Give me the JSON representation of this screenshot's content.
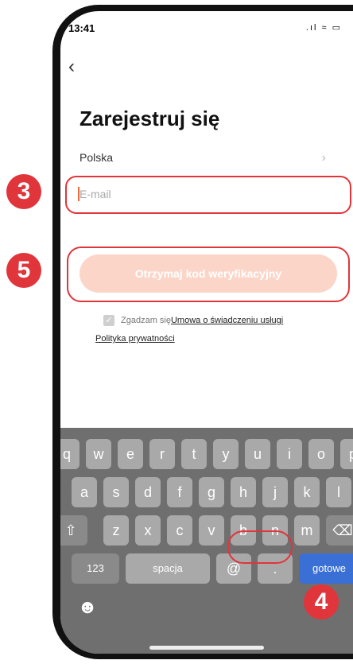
{
  "status_bar": {
    "time": "13:41",
    "icons": ".ıl ≈ ▭"
  },
  "nav": {
    "back_icon": "‹"
  },
  "page": {
    "title": "Zarejestruj się"
  },
  "country": {
    "label": "Polska",
    "chevron": "›"
  },
  "email": {
    "placeholder": "E-mail",
    "value": ""
  },
  "verify_button": {
    "label": "Otrzymaj kod weryfikacyjny"
  },
  "agreement": {
    "check": "✓",
    "text": "Zgadzam się",
    "service_link": "Umowa o świadczeniu usługi",
    "policy_link": "Polityka prywatności"
  },
  "keyboard": {
    "row1": [
      "q",
      "w",
      "e",
      "r",
      "t",
      "y",
      "u",
      "i",
      "o",
      "p"
    ],
    "row2": [
      "a",
      "s",
      "d",
      "f",
      "g",
      "h",
      "j",
      "k",
      "l"
    ],
    "row3": [
      "z",
      "x",
      "c",
      "v",
      "b",
      "n",
      "m"
    ],
    "shift": "⇧",
    "backspace": "⌫",
    "numbers": "123",
    "space": "spacja",
    "at": "@",
    "dot": ".",
    "done": "gotowe",
    "emoji": "☻"
  },
  "badges": {
    "three": "3",
    "five": "5",
    "four": "4"
  },
  "colors": {
    "accent": "#e0353b",
    "button_disabled": "#fbd5c8",
    "keyboard_bg": "#6f6f6f",
    "done_key": "#3a6fd6"
  }
}
